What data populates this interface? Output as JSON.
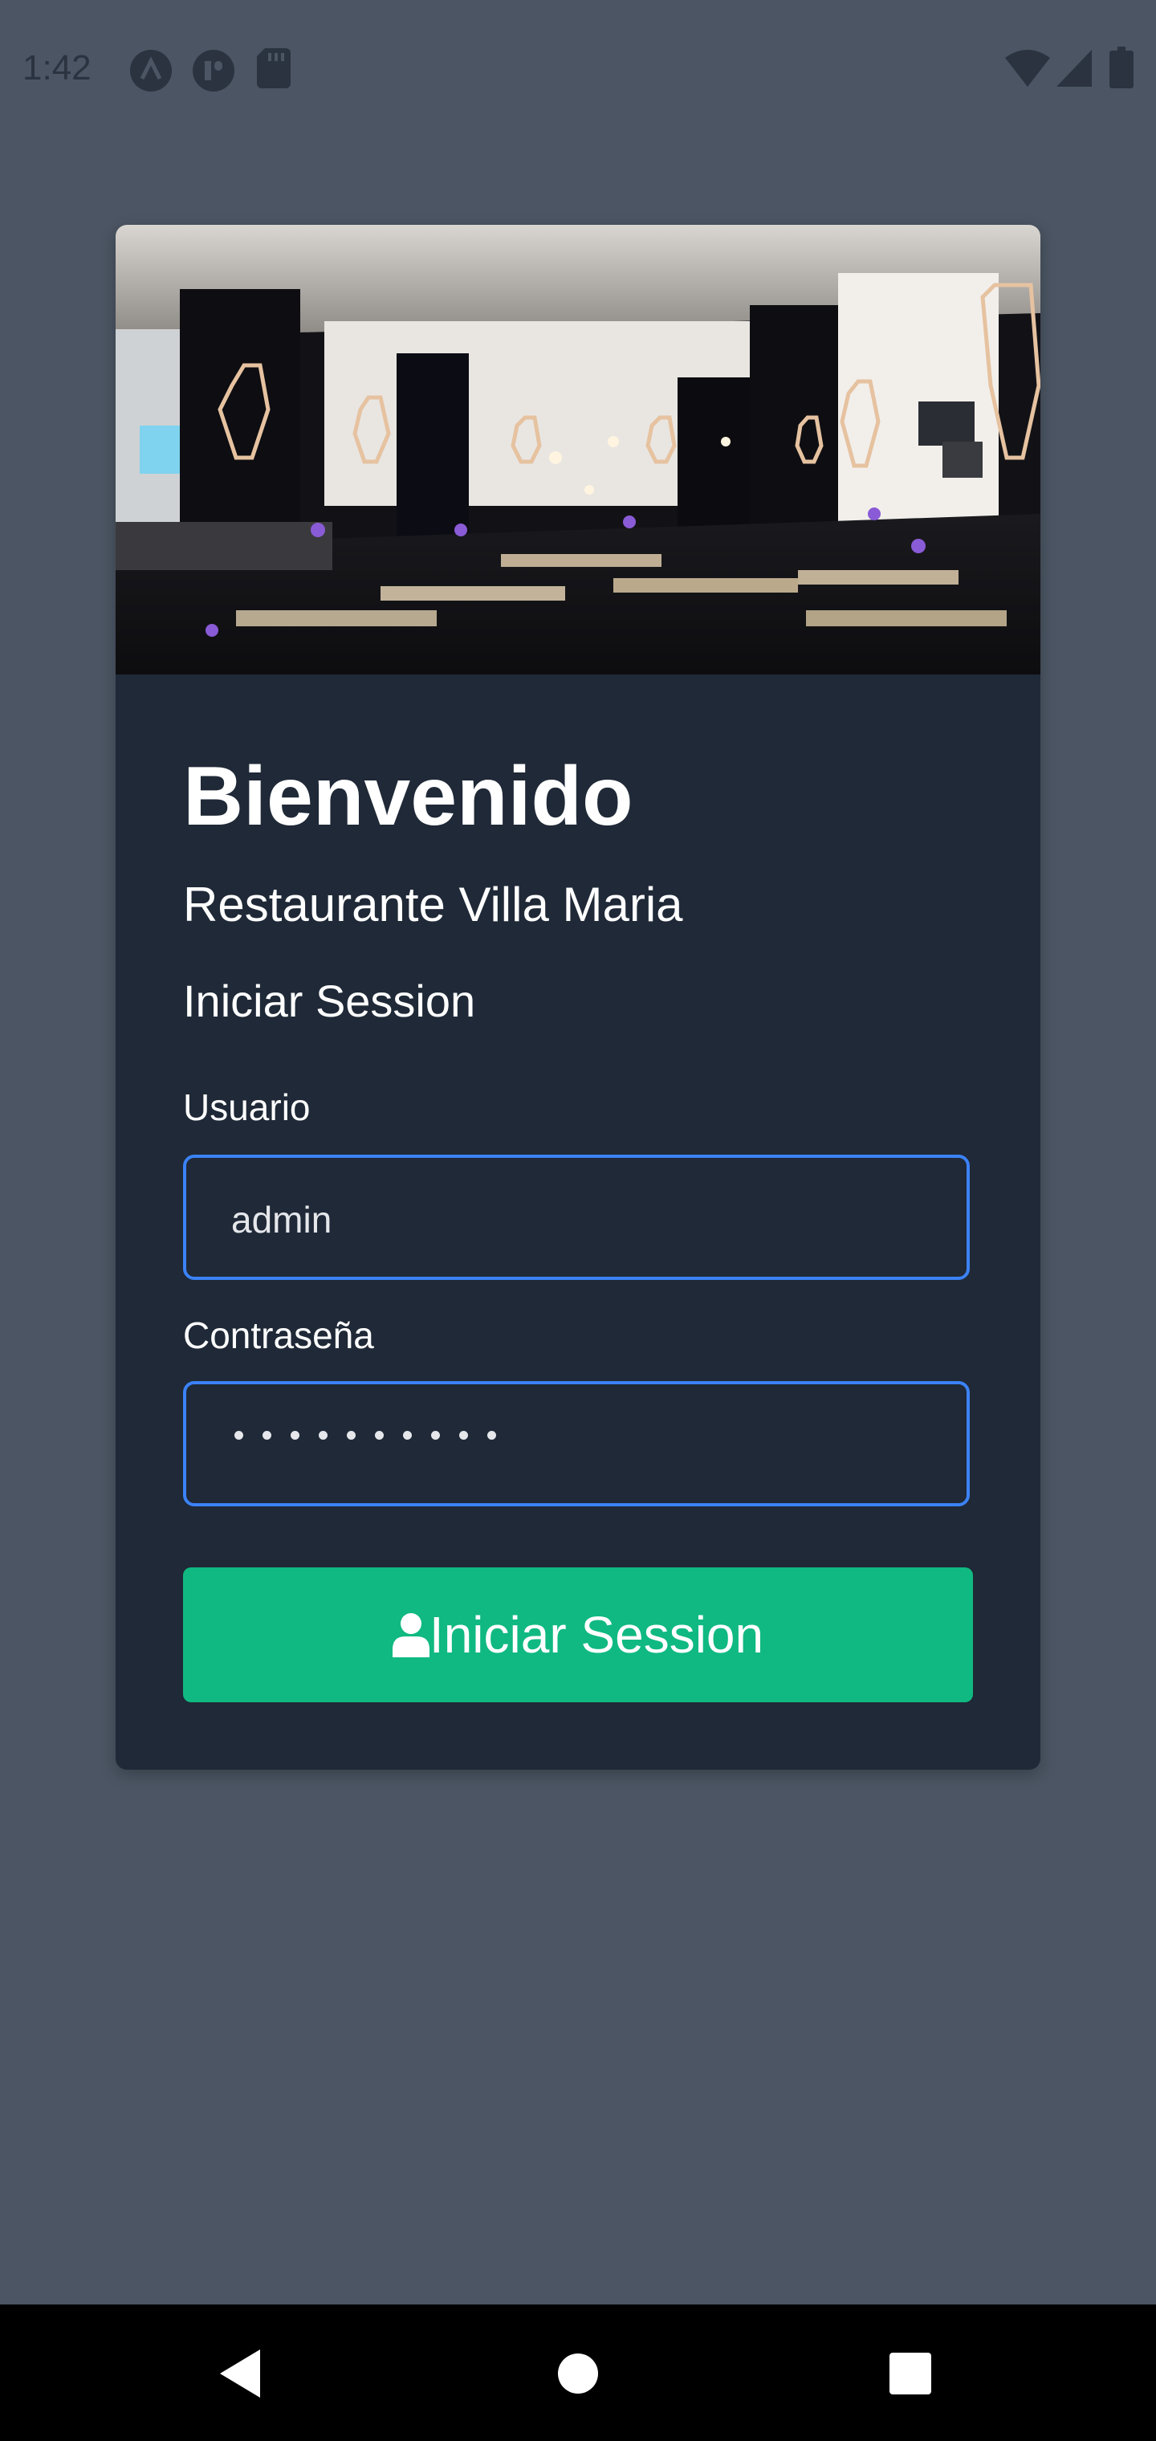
{
  "status_bar": {
    "time": "1:42",
    "left_icons": [
      "app-a-icon",
      "app-p-icon",
      "sd-card-icon"
    ],
    "right_icons": [
      "wifi-icon",
      "signal-icon",
      "battery-icon"
    ]
  },
  "card": {
    "hero_image": "restaurant-interior-image",
    "title": "Bienvenido",
    "subtitle": "Restaurante Villa Maria",
    "section_title": "Iniciar Session",
    "username": {
      "label": "Usuario",
      "value": "admin"
    },
    "password": {
      "label": "Contraseña",
      "masked_length": 10
    },
    "submit_button": {
      "label": "Iniciar Session",
      "icon": "user-icon"
    }
  },
  "nav_bar": {
    "icons": [
      "back-icon",
      "home-icon",
      "recents-icon"
    ]
  },
  "colors": {
    "background": "#4b5563",
    "card": "#1f2937",
    "input_border": "#3b82f6",
    "button": "#10b981"
  }
}
